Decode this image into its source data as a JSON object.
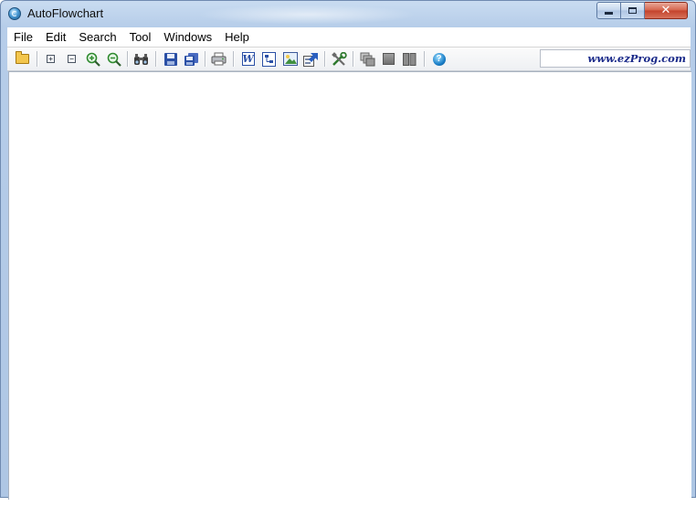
{
  "window": {
    "title": "AutoFlowchart"
  },
  "caption": {
    "minimize_icon": "minimize-icon",
    "maximize_icon": "restore-icon",
    "close_icon": "close-icon",
    "close_glyph": "✕"
  },
  "menu": {
    "items": [
      {
        "label": "File"
      },
      {
        "label": "Edit"
      },
      {
        "label": "Search"
      },
      {
        "label": "Tool"
      },
      {
        "label": "Windows"
      },
      {
        "label": "Help"
      }
    ]
  },
  "toolbar": {
    "buttons": [
      {
        "icon": "open-folder-icon"
      },
      {
        "icon": "expand-icon",
        "glyph": "+"
      },
      {
        "icon": "collapse-icon",
        "glyph": "−"
      },
      {
        "icon": "zoom-in-icon"
      },
      {
        "icon": "zoom-out-icon"
      },
      {
        "icon": "find-binoculars-icon"
      },
      {
        "icon": "save-icon"
      },
      {
        "icon": "save-all-icon"
      },
      {
        "icon": "print-icon"
      },
      {
        "icon": "export-word-icon",
        "glyph": "W"
      },
      {
        "icon": "export-visio-icon"
      },
      {
        "icon": "export-image-icon"
      },
      {
        "icon": "export-icon"
      },
      {
        "icon": "tools-icon"
      },
      {
        "icon": "cascade-windows-icon"
      },
      {
        "icon": "tile-horizontal-icon"
      },
      {
        "icon": "tile-vertical-icon"
      },
      {
        "icon": "help-icon",
        "glyph": "?"
      }
    ],
    "website": "www.ezProg.com"
  },
  "colors": {
    "titlebar": "#b6cde9",
    "close_button": "#c3412b",
    "client_area": "#ffffff",
    "link_text": "#1b2b8a"
  }
}
